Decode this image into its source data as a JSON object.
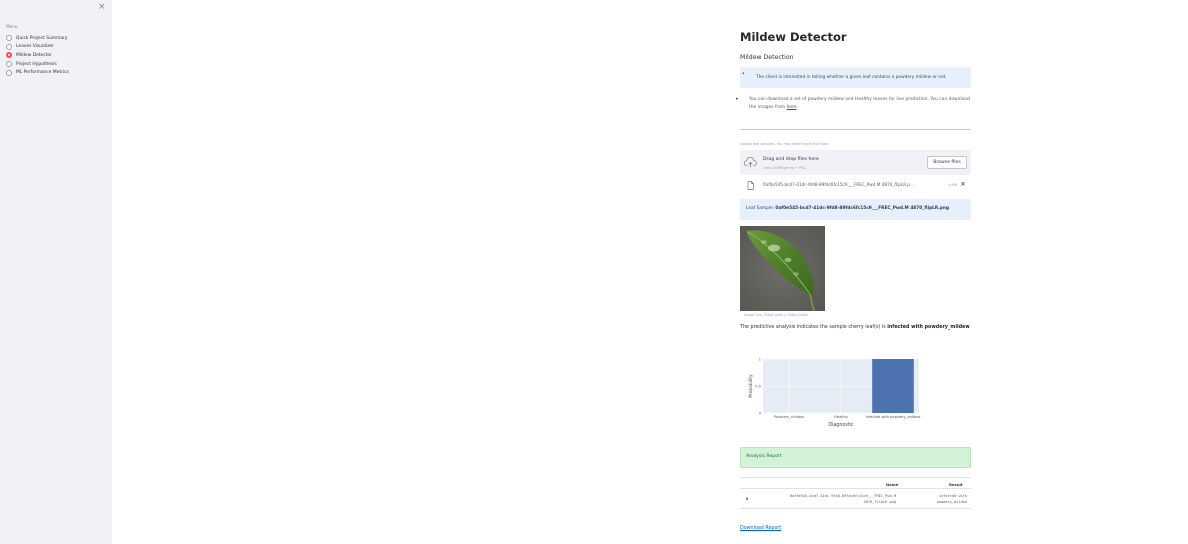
{
  "sidebar": {
    "close_symbol": "×",
    "menu_title": "Menu",
    "items": [
      {
        "label": "Quick Project Summary",
        "selected": false
      },
      {
        "label": "Leaves Visualizer",
        "selected": false
      },
      {
        "label": "Mildew Detector",
        "selected": true
      },
      {
        "label": "Project Hypothesis",
        "selected": false
      },
      {
        "label": "ML Performance Metrics",
        "selected": false
      }
    ]
  },
  "main": {
    "title": "Mildew Detector",
    "subheader": "Mildew Detection",
    "info_text": "The client is interested in telling whether a given leaf contains a powdery mildew or not.",
    "download_note": "You can download a set of powdery mildew and Healthy leaves for live prediction. You can download the images from",
    "download_link_text": "here",
    "uploader": {
      "label": "Upload leaf samples. You may select more than one.",
      "drop_title": "Drag and drop files here",
      "limit_text": "Limit 200MB per file • PNG",
      "browse_label": "Browse files"
    },
    "file": {
      "name": "0af0e545-bcd7-41dc-9fd8-89fdc6fc15c9___FREC_Pwd.M 4870_flipLR.p...",
      "size": "4.9KB",
      "remove_symbol": "×"
    },
    "leaf_sample_prefix": "Leaf Sample:",
    "leaf_sample_name": "0af0e545-bcd7-41dc-9fd8-89fdc6fc15c9___FREC_Pwd.M 4870_flipLR.png",
    "image_caption": "Image Size: 256px width x 256px height",
    "prediction_prefix": "The predictive analysis indicates the sample cherry leaf(s) is",
    "prediction_result": "infected with powdery_mildew",
    "success_text": "Analysis Report",
    "table": {
      "headers": {
        "index": "",
        "name": "Name",
        "result": "Result"
      },
      "rows": [
        {
          "index": "0",
          "name_line1": "0af0e545-bcd7-41dc-9fd8-89fdc6fc15c9___FREC_Pwd.M",
          "name_line2": "4870_flipLR.png",
          "result_line1": "infected with",
          "result_line2": "powdery_mildew"
        }
      ]
    },
    "download_report": "Download Report"
  },
  "chart_data": {
    "type": "bar",
    "categories": [
      "Powdery_mildew",
      "Healthy",
      "infected with powdery_mildew"
    ],
    "values": [
      0,
      0,
      1
    ],
    "xlabel": "Diagnostic",
    "ylabel": "Probability",
    "ylim": [
      0,
      1
    ],
    "yticks": [
      "0",
      "0.5",
      "1"
    ],
    "bar_color": "#4c72b0",
    "plot_bg": "#e5ecf6",
    "grid": true
  },
  "colors": {
    "accent": "#ff4b4b",
    "link": "#0068c9",
    "info_bg": "#e6f0fb",
    "success_bg": "#d3f3d8",
    "sidebar_bg": "#f0f2f6"
  },
  "icons": {
    "close": "close-icon",
    "upload": "cloud-upload-icon",
    "file": "file-icon",
    "remove": "close-icon"
  }
}
